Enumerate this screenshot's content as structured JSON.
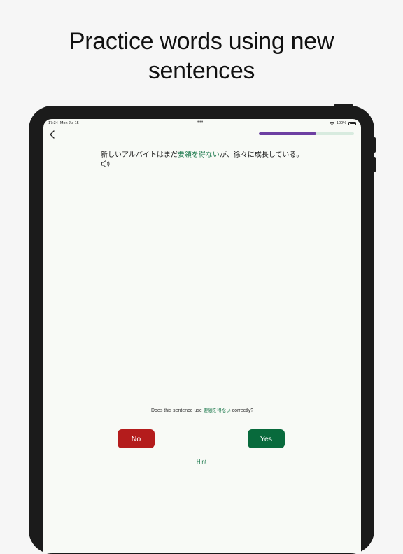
{
  "headline": {
    "line1": "Practice words using new",
    "line2": "sentences"
  },
  "status_bar": {
    "time": "17:34",
    "date": "Mon Jul 15",
    "dots": "•••",
    "battery": "100%"
  },
  "progress": {
    "value": 0.6
  },
  "sentence": {
    "before": "新しいアルバイトはまだ",
    "highlight": "要領を得ない",
    "after": "が、徐々に成長している。"
  },
  "question": {
    "before": "Does this sentence use ",
    "term": "要領を得ない",
    "after": " correctly?"
  },
  "buttons": {
    "no": "No",
    "yes": "Yes",
    "hint": "Hint"
  },
  "colors": {
    "accent_green": "#1e7a4e",
    "no_red": "#b41c1c",
    "yes_green": "#086a3c",
    "progress_purple": "#6d3fa2",
    "progress_track": "#d8ebdf"
  }
}
